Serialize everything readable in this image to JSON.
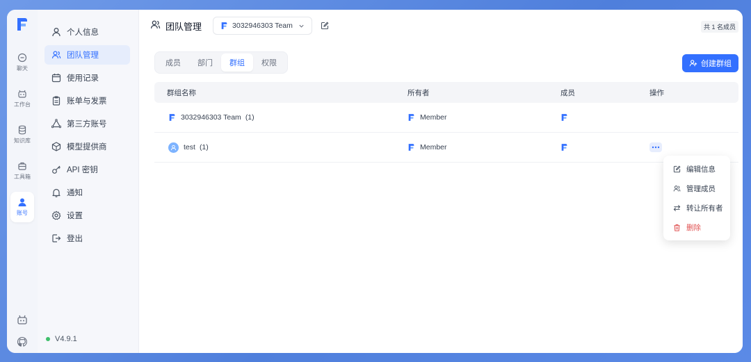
{
  "rail": {
    "items": [
      {
        "label": "聊天",
        "icon": "chat-icon"
      },
      {
        "label": "工作台",
        "icon": "robot-icon"
      },
      {
        "label": "知识库",
        "icon": "database-icon"
      },
      {
        "label": "工具箱",
        "icon": "toolbox-icon"
      },
      {
        "label": "账号",
        "icon": "user-icon"
      }
    ]
  },
  "sidebar": {
    "items": [
      {
        "label": "个人信息"
      },
      {
        "label": "团队管理"
      },
      {
        "label": "使用记录"
      },
      {
        "label": "账单与发票"
      },
      {
        "label": "第三方账号"
      },
      {
        "label": "模型提供商"
      },
      {
        "label": "API 密钥"
      },
      {
        "label": "通知"
      },
      {
        "label": "设置"
      },
      {
        "label": "登出"
      }
    ],
    "version": "V4.9.1"
  },
  "header": {
    "title": "团队管理",
    "team_name": "3032946303 Team",
    "member_count": "共 1 名成员"
  },
  "tabs": [
    {
      "label": "成员"
    },
    {
      "label": "部门"
    },
    {
      "label": "群组"
    },
    {
      "label": "权限"
    }
  ],
  "create_group_label": "创建群组",
  "table": {
    "headers": [
      "群组名称",
      "所有者",
      "成员",
      "操作"
    ],
    "rows": [
      {
        "name": "3032946303 Team",
        "count": "(1)",
        "owner": "Member"
      },
      {
        "name": "test",
        "count": "(1)",
        "owner": "Member"
      }
    ]
  },
  "menu": {
    "items": [
      {
        "label": "编辑信息"
      },
      {
        "label": "管理成员"
      },
      {
        "label": "转让所有者"
      },
      {
        "label": "删除"
      }
    ]
  },
  "colors": {
    "accent": "#3370ff",
    "danger": "#e05252"
  }
}
